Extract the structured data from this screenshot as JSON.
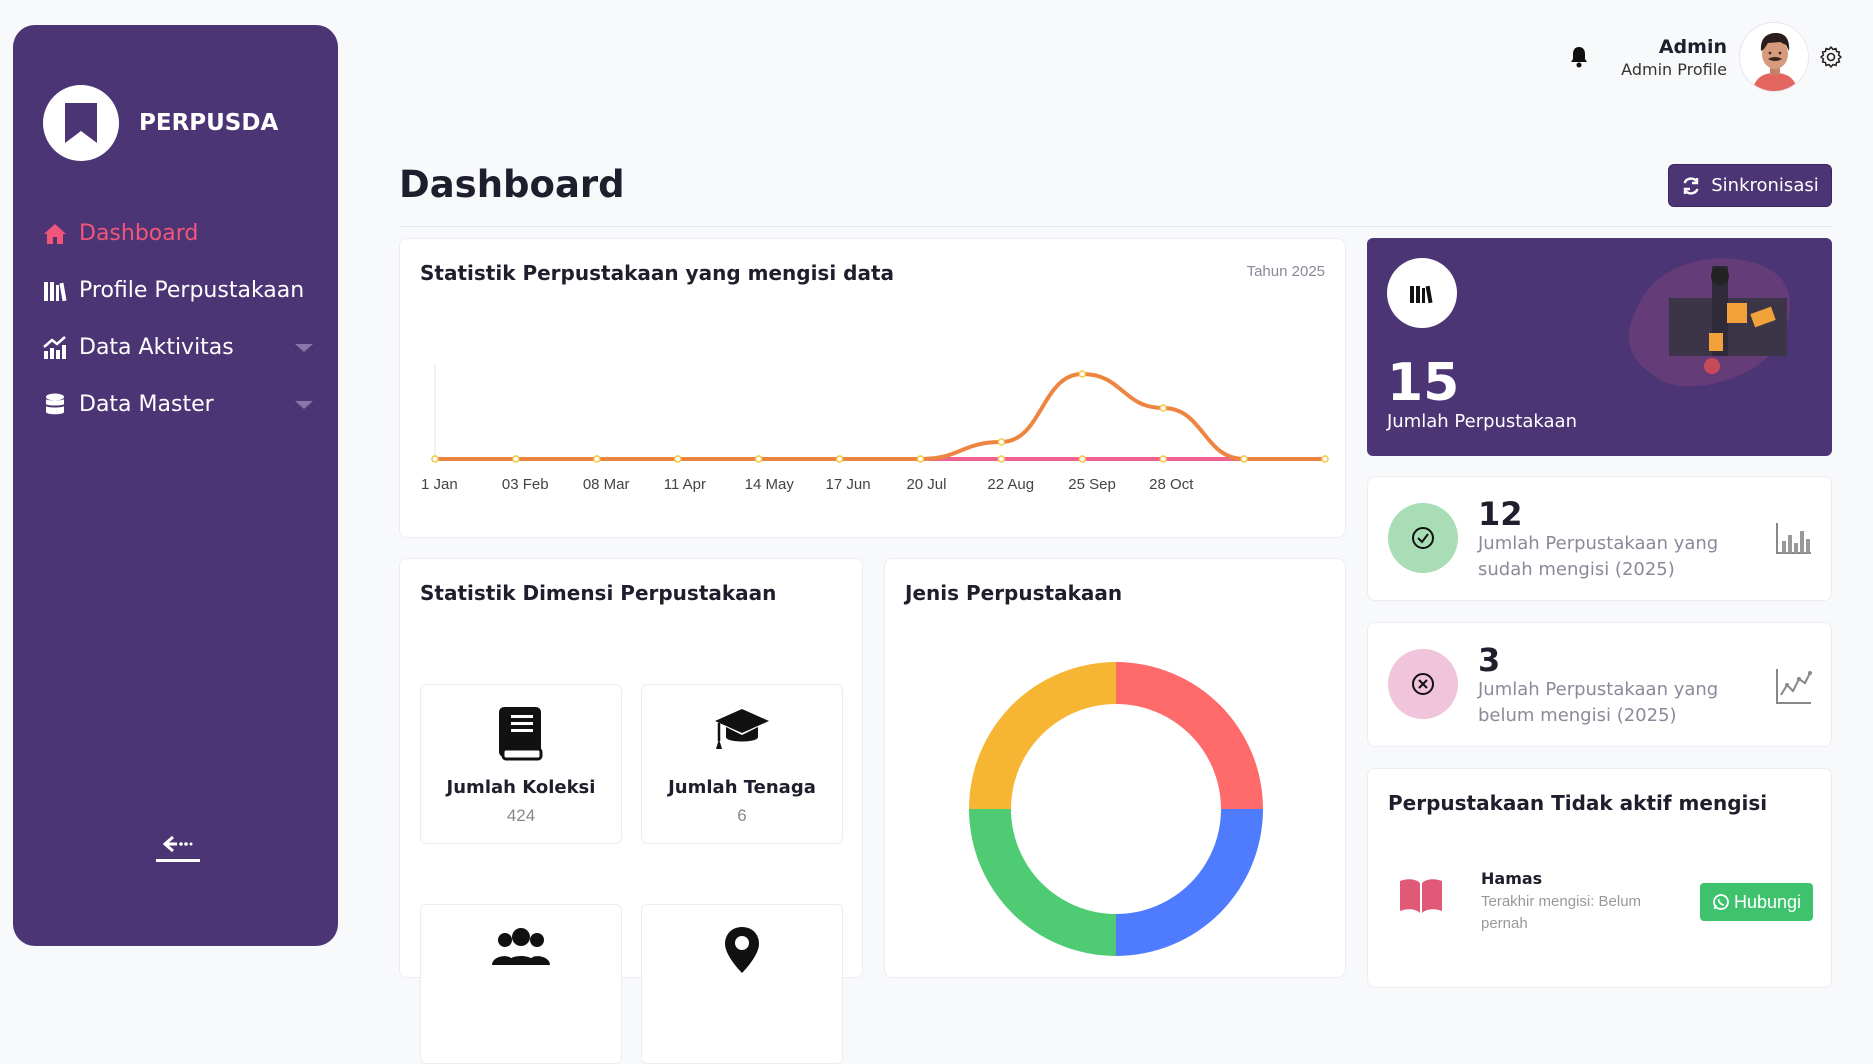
{
  "brand": {
    "name": "PERPUSDA"
  },
  "sidebar": {
    "items": [
      {
        "label": "Dashboard",
        "icon": "home-icon",
        "active": true
      },
      {
        "label": "Profile Perpustakaan",
        "icon": "books-icon"
      },
      {
        "label": "Data Aktivitas",
        "icon": "chart-up-icon",
        "has_submenu": true
      },
      {
        "label": "Data Master",
        "icon": "database-icon",
        "has_submenu": true
      }
    ],
    "collapse_icon": "collapse-left-icon"
  },
  "topbar": {
    "user_name": "Admin",
    "user_role": "Admin Profile",
    "bell_icon": "bell-icon",
    "gear_icon": "gear-icon"
  },
  "page": {
    "title": "Dashboard",
    "sync_label": "Sinkronisasi"
  },
  "stat_chart": {
    "title": "Statistik Perpustakaan yang mengisi data",
    "year_label": "Tahun 2025"
  },
  "chart_data": [
    {
      "type": "line",
      "x": [
        "1 Jan",
        "03 Feb",
        "08 Mar",
        "11 Apr",
        "14 May",
        "17 Jun",
        "20 Jul",
        "22 Aug",
        "25 Sep",
        "28 Oct",
        ""
      ],
      "series": [
        {
          "values": [
            0,
            0,
            0,
            0,
            0,
            0,
            0,
            1,
            5,
            3,
            0,
            0
          ],
          "color": "#ed8540"
        },
        {
          "values": [
            0,
            0,
            0,
            0,
            0,
            0,
            0,
            0,
            0,
            0,
            0,
            0
          ],
          "color": "#f0628f"
        }
      ],
      "title": "",
      "xlabel": "",
      "ylabel": "",
      "grid": false
    },
    {
      "type": "pie",
      "title": "Jenis Perpustakaan",
      "categories": [
        "",
        "",
        "",
        ""
      ],
      "values": [
        25,
        25,
        25,
        25
      ],
      "colors": [
        "#ff6b6b",
        "#4f7cff",
        "#4fcb74",
        "#f6b533"
      ],
      "donut": true
    }
  ],
  "dimensi": {
    "title": "Statistik Dimensi Perpustakaan",
    "tiles": [
      {
        "label": "Jumlah Koleksi",
        "value": "424",
        "icon": "book-icon"
      },
      {
        "label": "Jumlah Tenaga",
        "value": "6",
        "icon": "graduation-cap-icon"
      },
      {
        "label": "",
        "value": "",
        "icon": "users-icon"
      },
      {
        "label": "",
        "value": "",
        "icon": "map-pin-icon"
      }
    ]
  },
  "jenis": {
    "title": "Jenis Perpustakaan"
  },
  "summary": {
    "total_value": "15",
    "total_label": "Jumlah Perpustakaan",
    "filled_value": "12",
    "filled_label": "Jumlah Perpustakaan yang sudah mengisi (2025)",
    "unfilled_value": "3",
    "unfilled_label": "Jumlah Perpustakaan yang belum mengisi (2025)"
  },
  "inactive": {
    "title": "Perpustakaan Tidak aktif mengisi",
    "items": [
      {
        "name": "Hamas",
        "status": "Terakhir mengisi: Belum pernah",
        "button": "Hubungi"
      }
    ]
  },
  "colors": {
    "primary": "#4c3575",
    "accent": "#f2557a",
    "success": "#3ec26e"
  }
}
